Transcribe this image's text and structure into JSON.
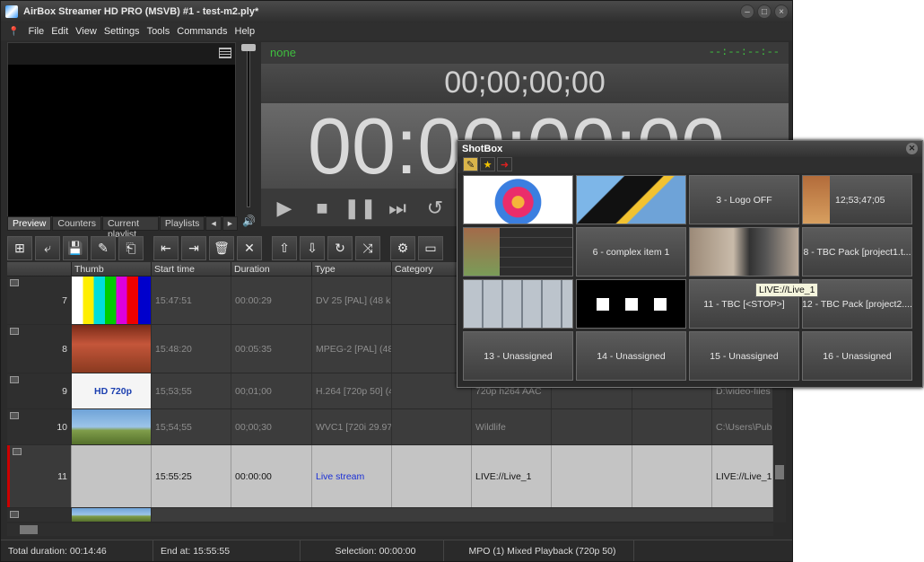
{
  "window": {
    "title": "AirBox Streamer HD PRO (MSVB) #1 - test-m2.ply*"
  },
  "menu": [
    "File",
    "Edit",
    "View",
    "Settings",
    "Tools",
    "Commands",
    "Help"
  ],
  "left_tabs": [
    "Preview",
    "Counters",
    "Current playlist",
    "Playlists"
  ],
  "timer": {
    "status": "none",
    "small_tc": "--:--:--:--",
    "countdown": "00;00;00;00",
    "big_time": "00:00:00:00"
  },
  "toolbar_icons": [
    "add-file-icon",
    "insert-icon",
    "save-icon",
    "save-as-icon",
    "import-icon",
    "move-left-icon",
    "move-right-icon",
    "delete-icon",
    "clear-icon",
    "move-up-icon",
    "move-down-icon",
    "loop-icon",
    "shuffle-icon",
    "settings-icon",
    "monitor-icon"
  ],
  "table": {
    "columns": [
      "",
      "Thumb",
      "Start time",
      "Duration",
      "Type",
      "Category",
      "",
      "",
      "",
      ""
    ],
    "rows": [
      {
        "num": "7",
        "thumb": "",
        "start": "15:47:51",
        "duration": "00:00:29",
        "type": "DV 25 [PAL] (48 kHz",
        "category": "",
        "c6": "",
        "c7": "",
        "c8": "",
        "c9": ""
      },
      {
        "num": "8",
        "thumb": "",
        "start": "15:48:20",
        "duration": "00:05:35",
        "type": "MPEG-2 [PAL] (48 k",
        "category": "",
        "c6": "",
        "c7": "",
        "c8": "",
        "c9": ""
      },
      {
        "num": "9",
        "thumb": "HD 720p",
        "start": "15;53;55",
        "duration": "00;01;00",
        "type": "H.264 [720p 50] (48",
        "category": "",
        "c6": "720p h264 AAC",
        "c7": "",
        "c8": "",
        "c9": "D:\\video-files"
      },
      {
        "num": "10",
        "thumb": "",
        "start": "15;54;55",
        "duration": "00;00;30",
        "type": "WVC1 [720i 29.97]",
        "category": "",
        "c6": "Wildlife",
        "c7": "",
        "c8": "",
        "c9": "C:\\Users\\Publ"
      },
      {
        "num": "11",
        "thumb": "",
        "start": "15:55:25",
        "duration": "00:00:00",
        "type": "Live stream",
        "category": "",
        "c6": "LIVE://Live_1",
        "c7": "",
        "c8": "",
        "c9": "LIVE://Live_1"
      }
    ]
  },
  "statusbar": {
    "total": "Total duration: 00:14:46",
    "end": "End at: 15:55:55",
    "selection": "Selection: 00:00:00",
    "mode": "MPO (1) Mixed Playback (720p 50)"
  },
  "shotbox": {
    "title": "ShotBox",
    "tiles": [
      {
        "label": "",
        "style": "img-star"
      },
      {
        "label": "",
        "style": "img-penguin"
      },
      {
        "label": "3 - Logo OFF",
        "style": ""
      },
      {
        "label": "12;53;47;05",
        "style": "split"
      },
      {
        "label": "",
        "style": "img-sheet"
      },
      {
        "label": "6 - complex item 1",
        "style": ""
      },
      {
        "label": "",
        "style": "img-news"
      },
      {
        "label": "8 - TBC Pack [project1.t...",
        "style": ""
      },
      {
        "label": "",
        "style": "img-keypad"
      },
      {
        "label": "",
        "style": "img-squares"
      },
      {
        "label": "11 - TBC [<STOP>]",
        "style": ""
      },
      {
        "label": "12 - TBC Pack [project2....",
        "style": ""
      },
      {
        "label": "13 - Unassigned",
        "style": ""
      },
      {
        "label": "14 - Unassigned",
        "style": ""
      },
      {
        "label": "15 - Unassigned",
        "style": ""
      },
      {
        "label": "16 - Unassigned",
        "style": ""
      }
    ],
    "tooltip": "LIVE://Live_1"
  }
}
